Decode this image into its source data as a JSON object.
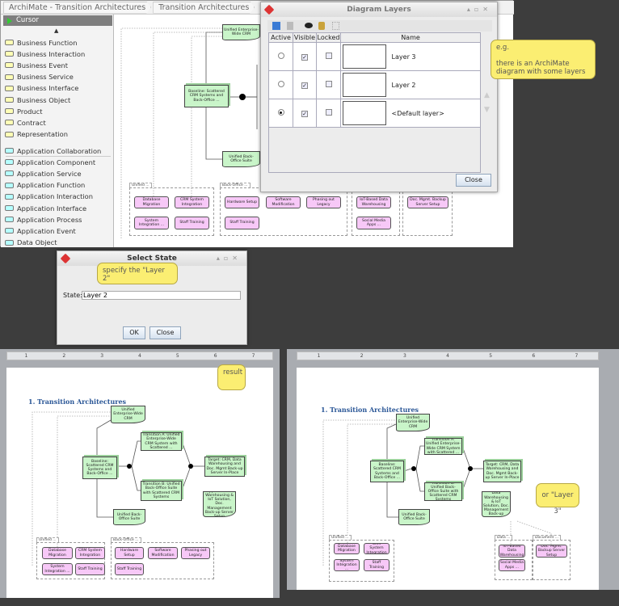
{
  "app": {
    "breadcrumbs": [
      "ArchiMate - Transition Architectures",
      "Transition Architectures"
    ],
    "palette": {
      "cursor_label": "Cursor",
      "business_items": [
        {
          "label": "Business Function",
          "icon": "business-function-icon"
        },
        {
          "label": "Business Interaction",
          "icon": "business-interaction-icon"
        },
        {
          "label": "Business Event",
          "icon": "business-event-icon"
        },
        {
          "label": "Business Service",
          "icon": "business-service-icon"
        },
        {
          "label": "Business Interface",
          "icon": "business-interface-icon"
        },
        {
          "label": "Business Object",
          "icon": "business-object-icon"
        },
        {
          "label": "Product",
          "icon": "product-icon"
        },
        {
          "label": "Contract",
          "icon": "contract-icon"
        },
        {
          "label": "Representation",
          "icon": "representation-icon"
        }
      ],
      "application_items": [
        {
          "label": "Application Collaboration",
          "icon": "application-collaboration-icon"
        },
        {
          "label": "Application Component",
          "icon": "application-component-icon"
        },
        {
          "label": "Application Service",
          "icon": "application-service-icon"
        },
        {
          "label": "Application Function",
          "icon": "application-function-icon"
        },
        {
          "label": "Application Interaction",
          "icon": "application-interaction-icon"
        },
        {
          "label": "Application Interface",
          "icon": "application-interface-icon"
        },
        {
          "label": "Application Process",
          "icon": "application-process-icon"
        },
        {
          "label": "Application Event",
          "icon": "application-event-icon"
        },
        {
          "label": "Data Object",
          "icon": "data-object-icon"
        }
      ],
      "colors": {
        "business": "#ffffb5",
        "application": "#b5ffff"
      }
    }
  },
  "layers_dialog": {
    "title": "Diagram Layers",
    "columns": [
      "Active",
      "Visible",
      "Locked",
      "Name"
    ],
    "rows": [
      {
        "name": "Layer 3",
        "active": false,
        "visible": true,
        "locked": false
      },
      {
        "name": "Layer 2",
        "active": false,
        "visible": true,
        "locked": false
      },
      {
        "name": "<Default layer>",
        "active": true,
        "visible": true,
        "locked": false
      }
    ],
    "close_label": "Close"
  },
  "callouts": {
    "layers": "e.g.\n\nthere is an ArchiMate diagram with some layers",
    "state": "specify the \"Layer 2\"",
    "result": "result",
    "layer3": "or \"Layer 3\""
  },
  "select_state": {
    "title": "Select State",
    "field_label": "State:",
    "field_value": "Layer 2",
    "ok_label": "OK",
    "close_label": "Close"
  },
  "documents": {
    "left": {
      "heading": "1. Transition Architectures",
      "ruler": [
        "1",
        "2",
        "3",
        "4",
        "5",
        "6",
        "7"
      ]
    },
    "right": {
      "heading": "1. Transition Architectures",
      "ruler": [
        "1",
        "2",
        "3",
        "4",
        "5",
        "6",
        "7"
      ]
    }
  },
  "diagrams": {
    "app": [
      {
        "label": "Unified Enterprise-Wide CRM",
        "kind": "deliv"
      },
      {
        "label": "Baseline: Scattered CRM Systems and Back-Office ...",
        "kind": "plateau"
      },
      {
        "label": "",
        "kind": "junction"
      },
      {
        "label": "Unified Back-Office Suite",
        "kind": "deliv"
      },
      {
        "label": "Unified ...",
        "kind": "group"
      },
      {
        "label": "Back-Office ...",
        "kind": "group"
      },
      {
        "label": "",
        "kind": "group"
      },
      {
        "label": "",
        "kind": "group"
      },
      {
        "label": "Database Migration",
        "kind": "work"
      },
      {
        "label": "CRM System Integration",
        "kind": "work"
      },
      {
        "label": "System Integration ...",
        "kind": "work"
      },
      {
        "label": "Staff Training",
        "kind": "work"
      },
      {
        "label": "Hardware Setup",
        "kind": "work"
      },
      {
        "label": "Software Modification",
        "kind": "work"
      },
      {
        "label": "Phasing out Legacy",
        "kind": "work"
      },
      {
        "label": "Staff Training",
        "kind": "work"
      },
      {
        "label": "IoT-Based Data Warehousing",
        "kind": "work"
      },
      {
        "label": "Social Media Apps ...",
        "kind": "work"
      },
      {
        "label": "Doc. Mgmt. Backup Server Setup",
        "kind": "work"
      }
    ],
    "doc_left": [
      {
        "label": "Unified Enterprise-Wide CRM",
        "kind": "deliv"
      },
      {
        "label": "Transition A: Unified Enterprise-Wide CRM System with Scattered ...",
        "kind": "plateau"
      },
      {
        "label": "Baseline: Scattered CRM Systems and Back-Office ...",
        "kind": "plateau"
      },
      {
        "label": "",
        "kind": "junction"
      },
      {
        "label": "",
        "kind": "junction"
      },
      {
        "label": "Target: CRM, Data Warehousing and Doc. Mgmt Back-up Server In-Place",
        "kind": "plateau"
      },
      {
        "label": "Transition B: Unified Back-Office Suite with Scattered CRM Systems",
        "kind": "plateau"
      },
      {
        "label": "Support of Data Warehousing & IoT Solution, Doc. Management Back-up Server Setup",
        "kind": "deliv"
      },
      {
        "label": "Unified Back-Office Suite",
        "kind": "deliv"
      },
      {
        "label": "Unified ...",
        "kind": "group"
      },
      {
        "label": "Back-Office ...",
        "kind": "group"
      },
      {
        "label": "Database Migration",
        "kind": "work"
      },
      {
        "label": "CRM System Integration",
        "kind": "work"
      },
      {
        "label": "System Integration ...",
        "kind": "work"
      },
      {
        "label": "Staff Training",
        "kind": "work"
      },
      {
        "label": "Hardware Setup",
        "kind": "work"
      },
      {
        "label": "Software Modification",
        "kind": "work"
      },
      {
        "label": "Phasing out Legacy",
        "kind": "work"
      },
      {
        "label": "Staff Training",
        "kind": "work"
      }
    ],
    "doc_right": [
      {
        "label": "Unified Enterprise-Wide CRM",
        "kind": "deliv"
      },
      {
        "label": "Transition A: Unified Enterprise-Wide CRM System with Scattered ...",
        "kind": "plateau"
      },
      {
        "label": "Baseline: Scattered CRM Systems and Back-Office ...",
        "kind": "plateau"
      },
      {
        "label": "",
        "kind": "junction"
      },
      {
        "label": "",
        "kind": "junction"
      },
      {
        "label": "Target: CRM, Data Warehousing and Doc. Mgmt Back-up Server In-Place",
        "kind": "plateau"
      },
      {
        "label": "Transition B: Unified Back-Office Suite with Scattered CRM Systems",
        "kind": "plateau"
      },
      {
        "label": "Support of Data Warehousing & IoT Solution, Doc. Management Back-up Server Setup",
        "kind": "deliv"
      },
      {
        "label": "Unified Back-Office Suite",
        "kind": "deliv"
      },
      {
        "label": "Unified ...",
        "kind": "group"
      },
      {
        "label": "Data ...",
        "kind": "group"
      },
      {
        "label": "Document ...",
        "kind": "group"
      },
      {
        "label": "Database Migration",
        "kind": "work"
      },
      {
        "label": "CRM System Integration",
        "kind": "work"
      },
      {
        "label": "System Integration ...",
        "kind": "work"
      },
      {
        "label": "Staff Training",
        "kind": "work"
      },
      {
        "label": "IoT-Based Data Warehousing",
        "kind": "work"
      },
      {
        "label": "Social Media Apps ...",
        "kind": "work"
      },
      {
        "label": "Doc. Mgmt. Backup Server Setup",
        "kind": "work"
      }
    ]
  }
}
